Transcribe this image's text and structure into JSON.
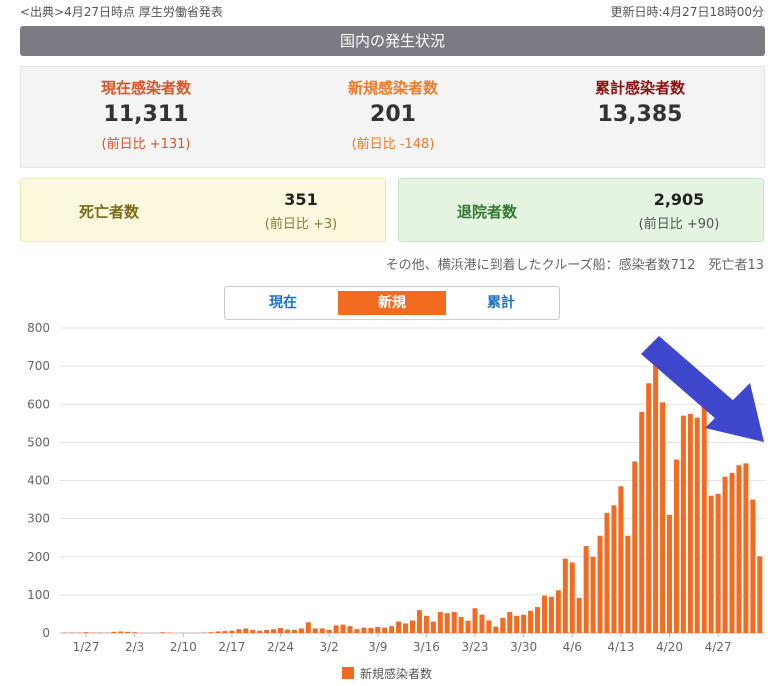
{
  "header": {
    "source": "<出典>4月27日時点 厚生労働省発表",
    "updated": "更新日時:4月27日18時00分",
    "title": "国内の発生状況"
  },
  "stats": {
    "current": {
      "label": "現在感染者数",
      "value": "11,311",
      "diff": "(前日比 +131)"
    },
    "new": {
      "label": "新規感染者数",
      "value": "201",
      "diff": "(前日比 -148)"
    },
    "total": {
      "label": "累計感染者数",
      "value": "13,385"
    }
  },
  "deaths": {
    "label": "死亡者数",
    "value": "351",
    "diff": "(前日比 +3)"
  },
  "recovered": {
    "label": "退院者数",
    "value": "2,905",
    "diff": "(前日比 +90)"
  },
  "cruise_note": "その他、横浜港に到着したクルーズ船：感染者数712　死亡者13",
  "tabs": [
    {
      "label": "現在",
      "active": false
    },
    {
      "label": "新規",
      "active": true
    },
    {
      "label": "累計",
      "active": false
    }
  ],
  "colors": {
    "bar": "#f26b21",
    "arrow": "#3f48cc"
  },
  "chart_data": {
    "type": "bar",
    "ylim": [
      0,
      800
    ],
    "yticks": [
      0,
      100,
      200,
      300,
      400,
      500,
      600,
      700,
      800
    ],
    "grid": true,
    "legend_position": "bottom",
    "tick_labels": [
      "1/27",
      "2/3",
      "2/10",
      "2/17",
      "2/24",
      "3/2",
      "3/9",
      "3/16",
      "3/23",
      "3/30",
      "4/6",
      "4/13",
      "4/20",
      "4/27"
    ],
    "categories": [
      "1/24",
      "1/25",
      "1/26",
      "1/27",
      "1/28",
      "1/29",
      "1/30",
      "1/31",
      "2/1",
      "2/2",
      "2/3",
      "2/4",
      "2/5",
      "2/6",
      "2/7",
      "2/8",
      "2/9",
      "2/10",
      "2/11",
      "2/12",
      "2/13",
      "2/14",
      "2/15",
      "2/16",
      "2/17",
      "2/18",
      "2/19",
      "2/20",
      "2/21",
      "2/22",
      "2/23",
      "2/24",
      "2/25",
      "2/26",
      "2/27",
      "2/28",
      "2/29",
      "3/1",
      "3/2",
      "3/3",
      "3/4",
      "3/5",
      "3/6",
      "3/7",
      "3/8",
      "3/9",
      "3/10",
      "3/11",
      "3/12",
      "3/13",
      "3/14",
      "3/15",
      "3/16",
      "3/17",
      "3/18",
      "3/19",
      "3/20",
      "3/21",
      "3/22",
      "3/23",
      "3/24",
      "3/25",
      "3/26",
      "3/27",
      "3/28",
      "3/29",
      "3/30",
      "3/31",
      "4/1",
      "4/2",
      "4/3",
      "4/4",
      "4/5",
      "4/6",
      "4/7",
      "4/8",
      "4/9",
      "4/10",
      "4/11",
      "4/12",
      "4/13",
      "4/14",
      "4/15",
      "4/16",
      "4/17",
      "4/18",
      "4/19",
      "4/20",
      "4/21",
      "4/22",
      "4/23",
      "4/24",
      "4/25",
      "4/26",
      "4/27"
    ],
    "series": [
      {
        "name": "新規感染者数",
        "values": [
          1,
          1,
          1,
          2,
          1,
          1,
          1,
          3,
          4,
          3,
          2,
          0,
          0,
          0,
          2,
          1,
          0,
          0,
          0,
          0,
          1,
          2,
          4,
          5,
          6,
          10,
          12,
          8,
          6,
          8,
          10,
          13,
          9,
          8,
          12,
          28,
          12,
          12,
          8,
          20,
          22,
          18,
          10,
          14,
          13,
          16,
          14,
          18,
          30,
          25,
          33,
          60,
          45,
          30,
          55,
          52,
          55,
          42,
          32,
          65,
          48,
          33,
          17,
          40,
          55,
          45,
          48,
          58,
          68,
          98,
          95,
          112,
          195,
          185,
          92,
          228,
          200,
          255,
          315,
          335,
          385,
          255,
          450,
          580,
          655,
          720,
          605,
          310,
          455,
          570,
          575,
          565,
          595,
          360,
          365,
          410,
          420,
          440,
          445,
          350,
          201
        ]
      }
    ]
  }
}
